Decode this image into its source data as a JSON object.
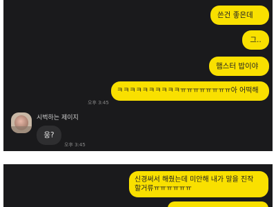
{
  "panel1": {
    "sent": [
      {
        "text": "쓴건 좋은데"
      },
      {
        "text": "그.."
      },
      {
        "text": "햄스터 밥이야"
      },
      {
        "text": "ㅋㅋㅋㅋㅋㅋㅋㅋㅋㅋㅠㅠㅠㅠㅠㅠㅠㅠ아 어떡해",
        "time": "오후 3:45"
      }
    ],
    "received": {
      "sender": "시벅하는 제이지",
      "text": "웅?",
      "time": "오후 3:45"
    }
  },
  "panel2": {
    "sent": [
      {
        "line1": "신경써서 해줬는데 미안해 내가 말을 진작",
        "line2": "할거류ㅠㅠㅠㅠㅠㅠ"
      }
    ]
  },
  "colors": {
    "background": "#1a1a1c",
    "sent_bubble": "#f9e000",
    "received_bubble": "#2e2e30",
    "page": "#ffffff"
  }
}
